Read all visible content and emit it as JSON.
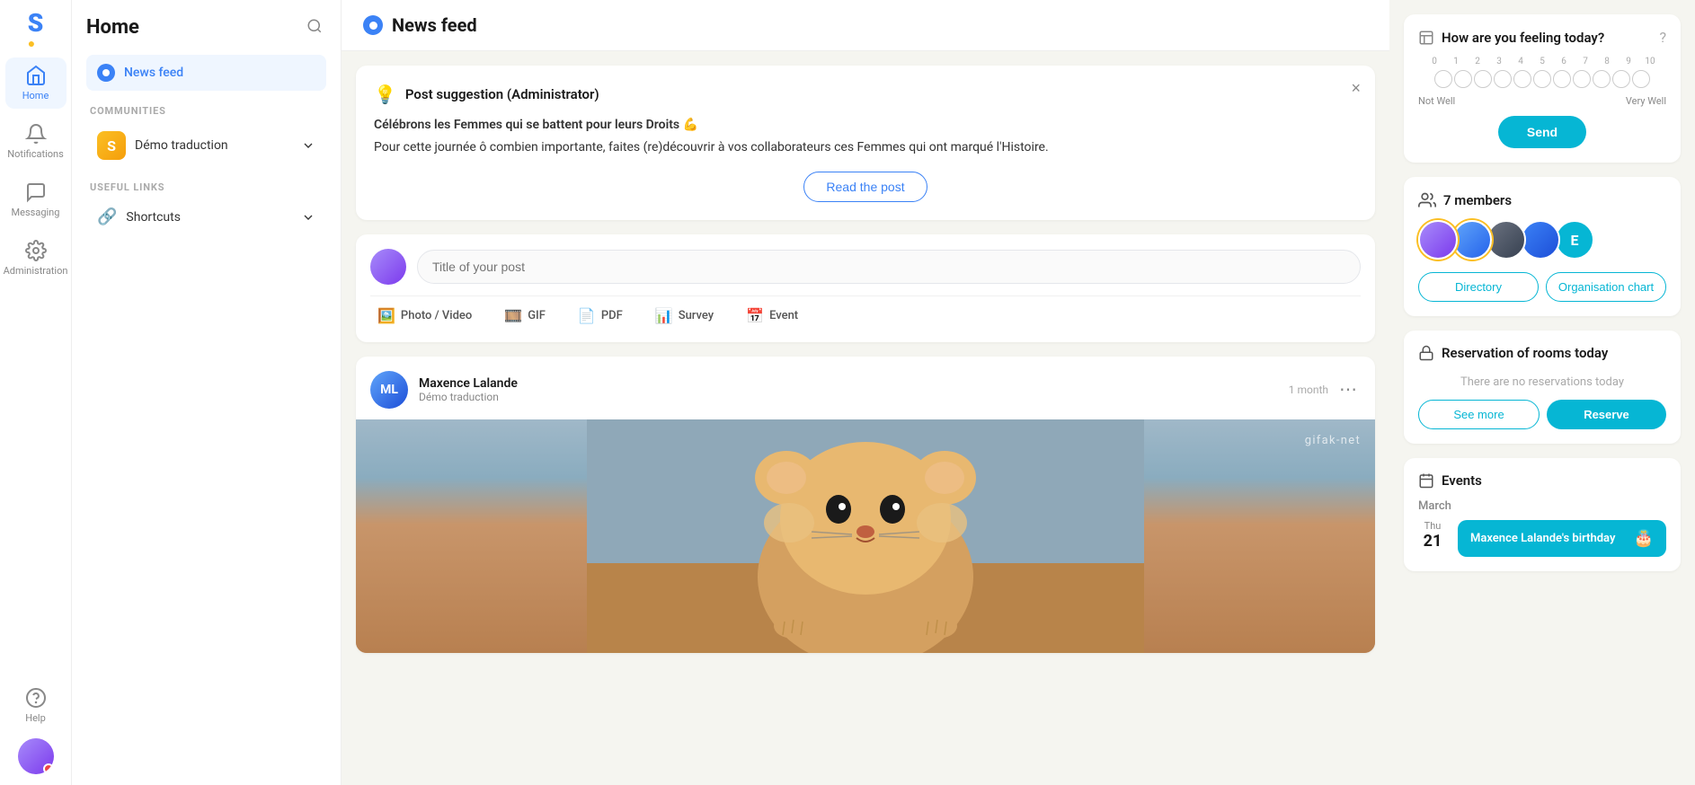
{
  "app": {
    "logo": "S",
    "url": "https://www.steeple.fr"
  },
  "left_nav": {
    "items": [
      {
        "id": "home",
        "label": "Home",
        "active": true
      },
      {
        "id": "notifications",
        "label": "Notifications",
        "active": false
      },
      {
        "id": "messaging",
        "label": "Messaging",
        "active": false
      },
      {
        "id": "administration",
        "label": "Administration",
        "active": false
      }
    ],
    "help_label": "Help"
  },
  "sidebar": {
    "title": "Home",
    "search_aria": "Search",
    "news_feed_label": "News feed",
    "communities_label": "COMMUNITIES",
    "community": {
      "name": "Démo traduction"
    },
    "useful_links_label": "USEFUL LINKS",
    "shortcuts_label": "Shortcuts"
  },
  "feed": {
    "title": "News feed",
    "suggestion": {
      "icon": "💡",
      "title": "Post suggestion (Administrator)",
      "body_line1": "Célébrons les Femmes qui se battent pour leurs Droits 💪",
      "body_line2": "Pour cette journée ô combien importante, faites (re)découvrir à vos collaborateurs ces Femmes qui ont marqué l'Histoire.",
      "cta_label": "Read the post"
    },
    "composer": {
      "placeholder": "Title of your post",
      "actions": [
        {
          "id": "photo-video",
          "label": "Photo / Video",
          "icon": "🖼"
        },
        {
          "id": "gif",
          "label": "GIF",
          "icon": "🎞"
        },
        {
          "id": "pdf",
          "label": "PDF",
          "icon": "📄"
        },
        {
          "id": "survey",
          "label": "Survey",
          "icon": "📊"
        },
        {
          "id": "event",
          "label": "Event",
          "icon": "📅"
        }
      ]
    },
    "posts": [
      {
        "id": "post-1",
        "author": "Maxence Lalande",
        "community": "Démo traduction",
        "timestamp": "1 month",
        "has_image": true,
        "image_watermark": "gifak-net"
      }
    ]
  },
  "right_panel": {
    "wellness": {
      "title": "How are you feeling today?",
      "scale_min": 0,
      "scale_max": 10,
      "label_low": "Not Well",
      "label_high": "Very Well",
      "send_label": "Send"
    },
    "members": {
      "icon": "👥",
      "count_label": "7 members",
      "avatars": [
        {
          "id": "m1",
          "color": "#c084fc",
          "ring": "yellow"
        },
        {
          "id": "m2",
          "color": "#60a5fa",
          "ring": "yellow"
        },
        {
          "id": "m3",
          "color": "#6b7280",
          "ring": "none"
        },
        {
          "id": "m4",
          "color": "#3b82f6",
          "ring": "none"
        },
        {
          "id": "m5",
          "initials": "E",
          "color": "#06b6d4",
          "ring": "none"
        }
      ],
      "directory_label": "Directory",
      "org_chart_label": "Organisation chart"
    },
    "reservation": {
      "icon": "🔒",
      "title": "Reservation of rooms today",
      "empty_message": "There are no reservations today",
      "see_more_label": "See more",
      "reserve_label": "Reserve"
    },
    "events": {
      "icon": "📅",
      "title": "Events",
      "month": "March",
      "items": [
        {
          "day_label": "Thu",
          "day_num": "21",
          "name": "Maxence Lalande's birthday",
          "emoji": "🎂"
        }
      ]
    }
  }
}
